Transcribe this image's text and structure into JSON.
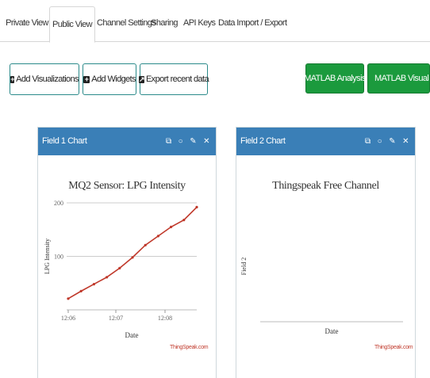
{
  "tabs": [
    "Private View",
    "Public View",
    "Channel Settings",
    "Sharing",
    "API Keys",
    "Data Import / Export"
  ],
  "buttons": {
    "add_visualizations": "Add Visualizations",
    "add_widgets": "Add Widgets",
    "export_recent": "Export recent data",
    "matlab_analysis": "MATLAB Analysis",
    "matlab_visualization": "MATLAB Visualization"
  },
  "field1": {
    "header": "Field 1 Chart",
    "credit": "ThingSpeak.com"
  },
  "field2": {
    "header": "Field 2 Chart",
    "credit": "ThingSpeak.com"
  },
  "colors": {
    "header_blue": "#3a7fb7",
    "matlab_green": "#1b9a3d",
    "series_red": "#c0392b"
  },
  "chart_data": [
    {
      "type": "line",
      "title": "MQ2 Sensor: LPG Intensity",
      "xlabel": "Date",
      "ylabel": "LPG Intensity",
      "x_ticks": [
        "12:06",
        "12:07",
        "12:08"
      ],
      "y_ticks": [
        100,
        200
      ],
      "ylim": [
        0,
        200
      ],
      "grid": true,
      "series": [
        {
          "values": [
            21,
            35,
            48,
            61,
            78,
            98,
            121,
            138,
            155,
            168,
            192
          ]
        }
      ]
    },
    {
      "type": "line",
      "title": "Thingspeak Free Channel",
      "xlabel": "Date",
      "ylabel": "Field 2",
      "series": []
    }
  ]
}
